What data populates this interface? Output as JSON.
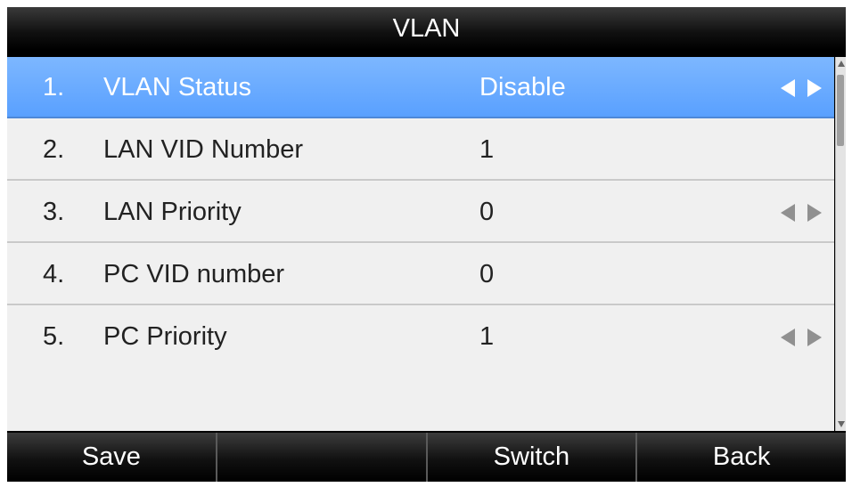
{
  "title": "VLAN",
  "rows": [
    {
      "num": "1.",
      "label": "VLAN Status",
      "value": "Disable",
      "selected": true,
      "arrows": true
    },
    {
      "num": "2.",
      "label": "LAN VID Number",
      "value": "1",
      "selected": false,
      "arrows": false
    },
    {
      "num": "3.",
      "label": "LAN Priority",
      "value": "0",
      "selected": false,
      "arrows": true
    },
    {
      "num": "4.",
      "label": "PC VID number",
      "value": "0",
      "selected": false,
      "arrows": false
    },
    {
      "num": "5.",
      "label": "PC Priority",
      "value": "1",
      "selected": false,
      "arrows": true
    }
  ],
  "softkeys": [
    "Save",
    "",
    "Switch",
    "Back"
  ],
  "colors": {
    "selected": "#59a0ff",
    "bar": "#000000",
    "row": "#f0f0f0"
  }
}
